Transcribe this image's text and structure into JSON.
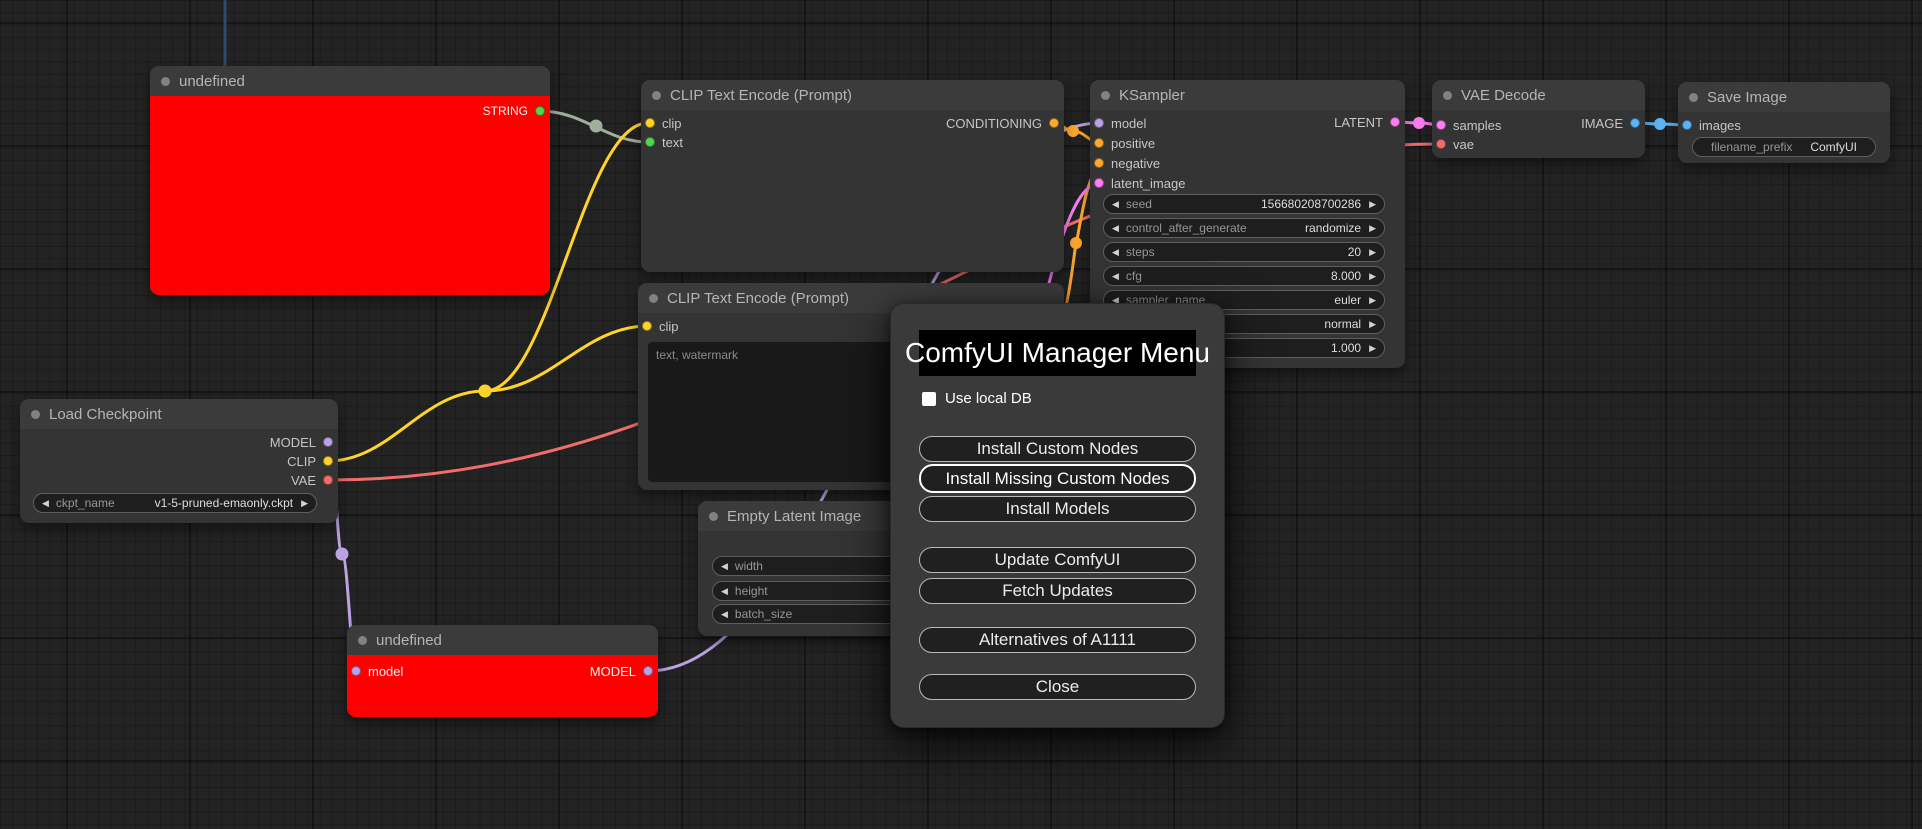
{
  "icons": {
    "left_arrow": "◀",
    "right_arrow": "▶"
  },
  "colors": {
    "model": "#b9a3e3",
    "clip": "#ffd42a",
    "vae": "#f36c6c",
    "conditioning": "#ffa931",
    "latent": "#ff7ef3",
    "image": "#5db4f5",
    "string_green": "#52d452",
    "string_wire": "#a2ae9d",
    "offscreen_link": "#2d4a6e",
    "node_red": "#ff0000"
  },
  "nodes": {
    "undef_top": {
      "title": "undefined",
      "output": "STRING"
    },
    "clip1": {
      "title": "CLIP Text Encode (Prompt)",
      "inputs": [
        "clip",
        "text"
      ],
      "output": "CONDITIONING"
    },
    "clip2": {
      "title": "CLIP Text Encode (Prompt)",
      "inputs": [
        "clip"
      ],
      "text_value": "text, watermark"
    },
    "ksampler": {
      "title": "KSampler",
      "inputs": [
        "model",
        "positive",
        "negative",
        "latent_image"
      ],
      "output": "LATENT",
      "widgets": [
        {
          "label": "seed",
          "value": "156680208700286"
        },
        {
          "label": "control_after_generate",
          "value": "randomize"
        },
        {
          "label": "steps",
          "value": "20"
        },
        {
          "label": "cfg",
          "value": "8.000"
        },
        {
          "label": "sampler_name",
          "value": "euler"
        },
        {
          "label": "",
          "value": "normal"
        },
        {
          "label": "",
          "value": "1.000"
        }
      ]
    },
    "vae_decode": {
      "title": "VAE Decode",
      "inputs": [
        "samples",
        "vae"
      ],
      "output": "IMAGE"
    },
    "save_image": {
      "title": "Save Image",
      "inputs": [
        "images"
      ],
      "widgets": [
        {
          "label": "filename_prefix",
          "value": "ComfyUI"
        }
      ]
    },
    "load_checkpoint": {
      "title": "Load Checkpoint",
      "outputs": [
        "MODEL",
        "CLIP",
        "VAE"
      ],
      "widgets": [
        {
          "label": "ckpt_name",
          "value": "v1-5-pruned-emaonly.ckpt"
        }
      ]
    },
    "empty_latent": {
      "title": "Empty Latent Image",
      "widgets": [
        {
          "label": "width"
        },
        {
          "label": "height"
        },
        {
          "label": "batch_size"
        }
      ]
    },
    "undef_bottom": {
      "title": "undefined",
      "inputs": [
        "model"
      ],
      "output": "MODEL"
    }
  },
  "dialog": {
    "title": "ComfyUI Manager Menu",
    "checkbox_label": "Use local DB",
    "buttons": [
      "Install Custom Nodes",
      "Install Missing Custom Nodes",
      "Install Models",
      "Update ComfyUI",
      "Fetch Updates",
      "Alternatives of A1111",
      "Close"
    ]
  }
}
